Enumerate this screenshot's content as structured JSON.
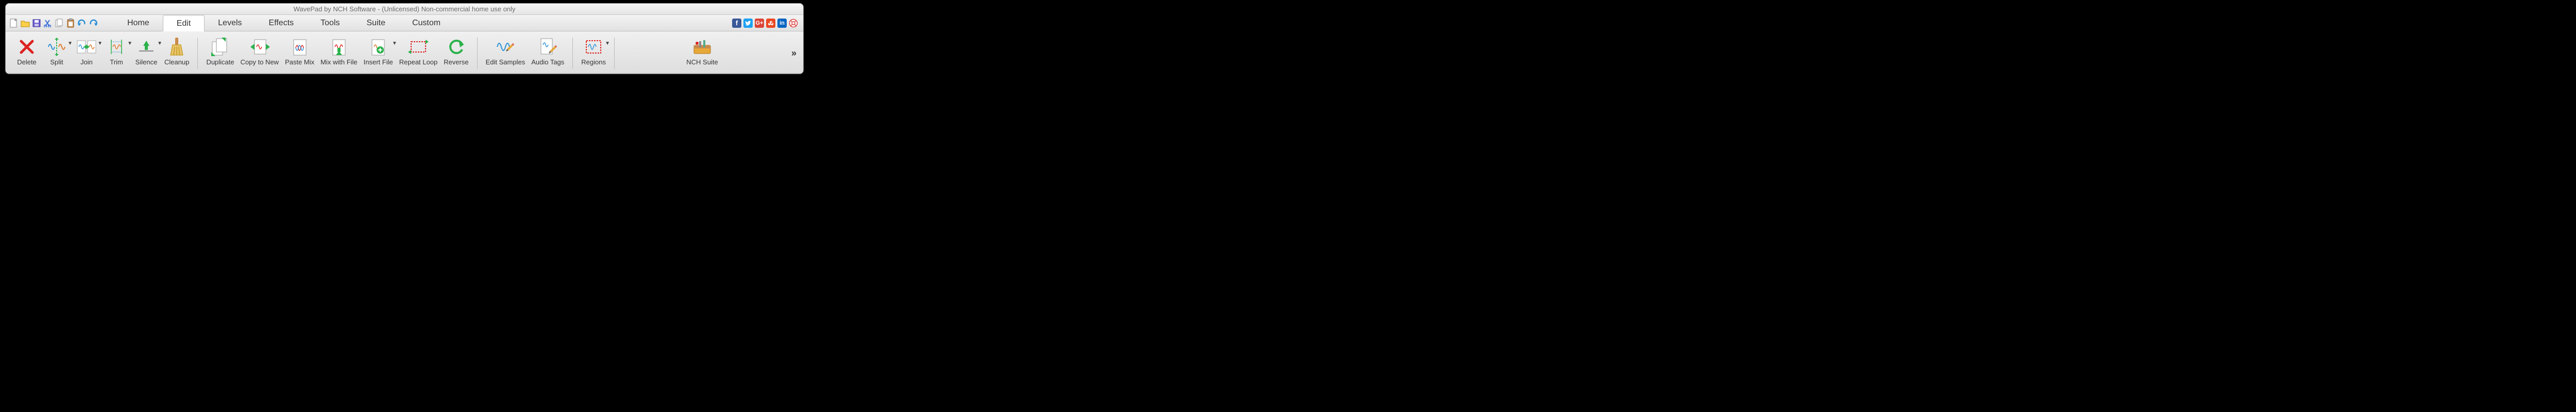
{
  "title": "WavePad by NCH Software - (Unlicensed) Non-commercial home use only",
  "quickAccess": [
    {
      "name": "new-file-icon"
    },
    {
      "name": "open-folder-icon"
    },
    {
      "name": "save-icon"
    },
    {
      "name": "cut-icon"
    },
    {
      "name": "copy-icon"
    },
    {
      "name": "paste-icon"
    },
    {
      "name": "undo-icon"
    },
    {
      "name": "redo-icon"
    }
  ],
  "tabs": [
    {
      "label": "Home",
      "active": false
    },
    {
      "label": "Edit",
      "active": true
    },
    {
      "label": "Levels",
      "active": false
    },
    {
      "label": "Effects",
      "active": false
    },
    {
      "label": "Tools",
      "active": false
    },
    {
      "label": "Suite",
      "active": false
    },
    {
      "label": "Custom",
      "active": false
    }
  ],
  "social": [
    {
      "name": "facebook-icon",
      "bg": "#3b5998"
    },
    {
      "name": "twitter-icon",
      "bg": "#1da1f2"
    },
    {
      "name": "google-plus-icon",
      "bg": "#db4437"
    },
    {
      "name": "stumbleupon-icon",
      "bg": "#eb4924"
    },
    {
      "name": "linkedin-icon",
      "bg": "#0a66c2"
    },
    {
      "name": "help-lifebuoy-icon",
      "bg": "transparent"
    }
  ],
  "ribbon": {
    "groups": [
      [
        {
          "label": "Delete",
          "name": "delete-button",
          "icon": "delete-x-icon",
          "dropdown": false
        },
        {
          "label": "Split",
          "name": "split-button",
          "icon": "split-icon",
          "dropdown": true
        },
        {
          "label": "Join",
          "name": "join-button",
          "icon": "join-icon",
          "dropdown": true
        },
        {
          "label": "Trim",
          "name": "trim-button",
          "icon": "trim-icon",
          "dropdown": true
        },
        {
          "label": "Silence",
          "name": "silence-button",
          "icon": "silence-icon",
          "dropdown": true
        },
        {
          "label": "Cleanup",
          "name": "cleanup-button",
          "icon": "cleanup-brush-icon",
          "dropdown": false
        }
      ],
      [
        {
          "label": "Duplicate",
          "name": "duplicate-button",
          "icon": "duplicate-icon",
          "dropdown": false
        },
        {
          "label": "Copy to New",
          "name": "copy-to-new-button",
          "icon": "copy-to-new-icon",
          "dropdown": false
        },
        {
          "label": "Paste Mix",
          "name": "paste-mix-button",
          "icon": "paste-mix-icon",
          "dropdown": false
        },
        {
          "label": "Mix with File",
          "name": "mix-with-file-button",
          "icon": "mix-with-file-icon",
          "dropdown": false
        },
        {
          "label": "Insert File",
          "name": "insert-file-button",
          "icon": "insert-file-icon",
          "dropdown": true
        },
        {
          "label": "Repeat Loop",
          "name": "repeat-loop-button",
          "icon": "repeat-loop-icon",
          "dropdown": false
        },
        {
          "label": "Reverse",
          "name": "reverse-button",
          "icon": "reverse-icon",
          "dropdown": false
        }
      ],
      [
        {
          "label": "Edit Samples",
          "name": "edit-samples-button",
          "icon": "edit-samples-icon",
          "dropdown": false
        },
        {
          "label": "Audio Tags",
          "name": "audio-tags-button",
          "icon": "audio-tags-icon",
          "dropdown": false
        }
      ],
      [
        {
          "label": "Regions",
          "name": "regions-button",
          "icon": "regions-icon",
          "dropdown": true
        }
      ],
      [
        {
          "label": "NCH Suite",
          "name": "nch-suite-button",
          "icon": "toolbox-icon",
          "dropdown": false
        }
      ]
    ]
  }
}
